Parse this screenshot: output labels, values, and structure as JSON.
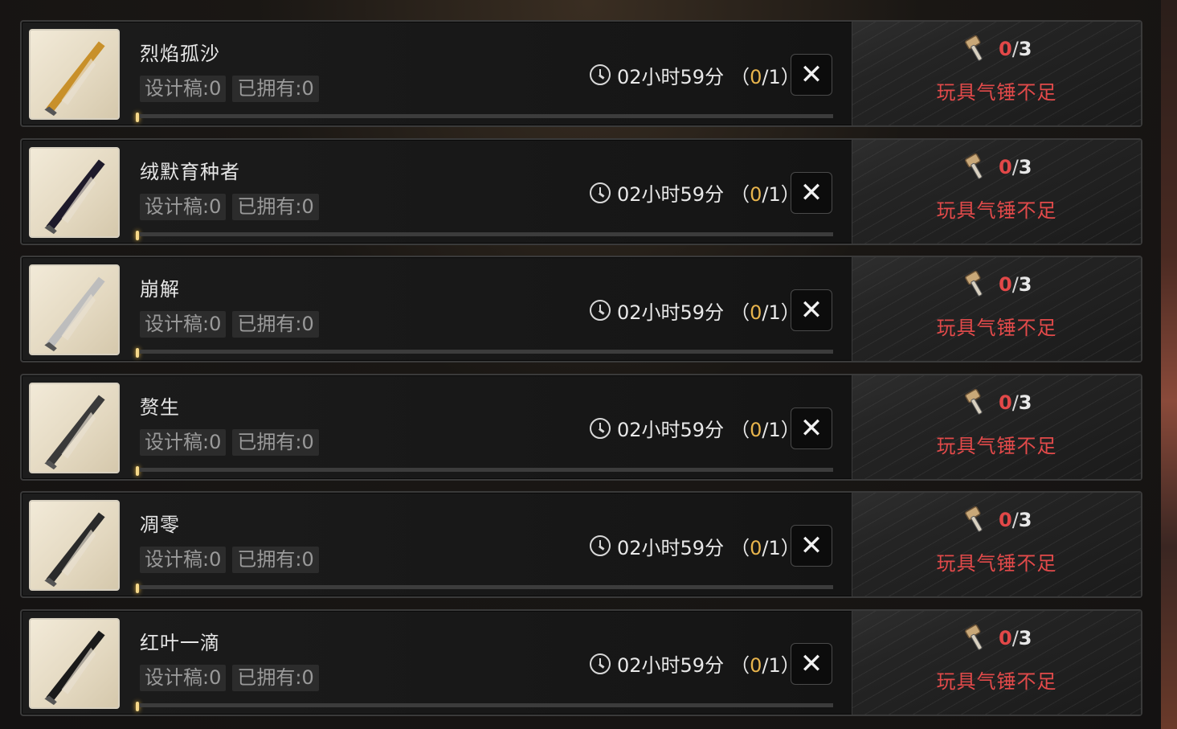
{
  "items": [
    {
      "name": "烈焰孤沙",
      "design_label": "设计稿:0",
      "owned_label": "已拥有:0",
      "time": "02小时59分",
      "paren_open": "（",
      "queue_have": "0",
      "queue_total": "/1",
      "paren_close": "）",
      "cancel": "✕",
      "hammer_have": "0",
      "hammer_sep": "/",
      "hammer_need": "3",
      "status": "玩具气锤不足",
      "weapon_color": "#c8902a"
    },
    {
      "name": "绒默育种者",
      "design_label": "设计稿:0",
      "owned_label": "已拥有:0",
      "time": "02小时59分",
      "paren_open": "（",
      "queue_have": "0",
      "queue_total": "/1",
      "paren_close": "）",
      "cancel": "✕",
      "hammer_have": "0",
      "hammer_sep": "/",
      "hammer_need": "3",
      "status": "玩具气锤不足",
      "weapon_color": "#1e1a2a"
    },
    {
      "name": "崩解",
      "design_label": "设计稿:0",
      "owned_label": "已拥有:0",
      "time": "02小时59分",
      "paren_open": "（",
      "queue_have": "0",
      "queue_total": "/1",
      "paren_close": "）",
      "cancel": "✕",
      "hammer_have": "0",
      "hammer_sep": "/",
      "hammer_need": "3",
      "status": "玩具气锤不足",
      "weapon_color": "#bdbdbd"
    },
    {
      "name": "赘生",
      "design_label": "设计稿:0",
      "owned_label": "已拥有:0",
      "time": "02小时59分",
      "paren_open": "（",
      "queue_have": "0",
      "queue_total": "/1",
      "paren_close": "）",
      "cancel": "✕",
      "hammer_have": "0",
      "hammer_sep": "/",
      "hammer_need": "3",
      "status": "玩具气锤不足",
      "weapon_color": "#3a3a3a"
    },
    {
      "name": "凋零",
      "design_label": "设计稿:0",
      "owned_label": "已拥有:0",
      "time": "02小时59分",
      "paren_open": "（",
      "queue_have": "0",
      "queue_total": "/1",
      "paren_close": "）",
      "cancel": "✕",
      "hammer_have": "0",
      "hammer_sep": "/",
      "hammer_need": "3",
      "status": "玩具气锤不足",
      "weapon_color": "#2a2a2a"
    },
    {
      "name": "红叶一滴",
      "design_label": "设计稿:0",
      "owned_label": "已拥有:0",
      "time": "02小时59分",
      "paren_open": "（",
      "queue_have": "0",
      "queue_total": "/1",
      "paren_close": "）",
      "cancel": "✕",
      "hammer_have": "0",
      "hammer_sep": "/",
      "hammer_need": "3",
      "status": "玩具气锤不足",
      "weapon_color": "#1a1a1a"
    }
  ],
  "colors": {
    "accent_gold": "#e8b44c",
    "warning_red": "#e24848"
  },
  "icons": {
    "timer": "clock-icon",
    "cancel": "close-icon",
    "material": "hammer-icon"
  }
}
